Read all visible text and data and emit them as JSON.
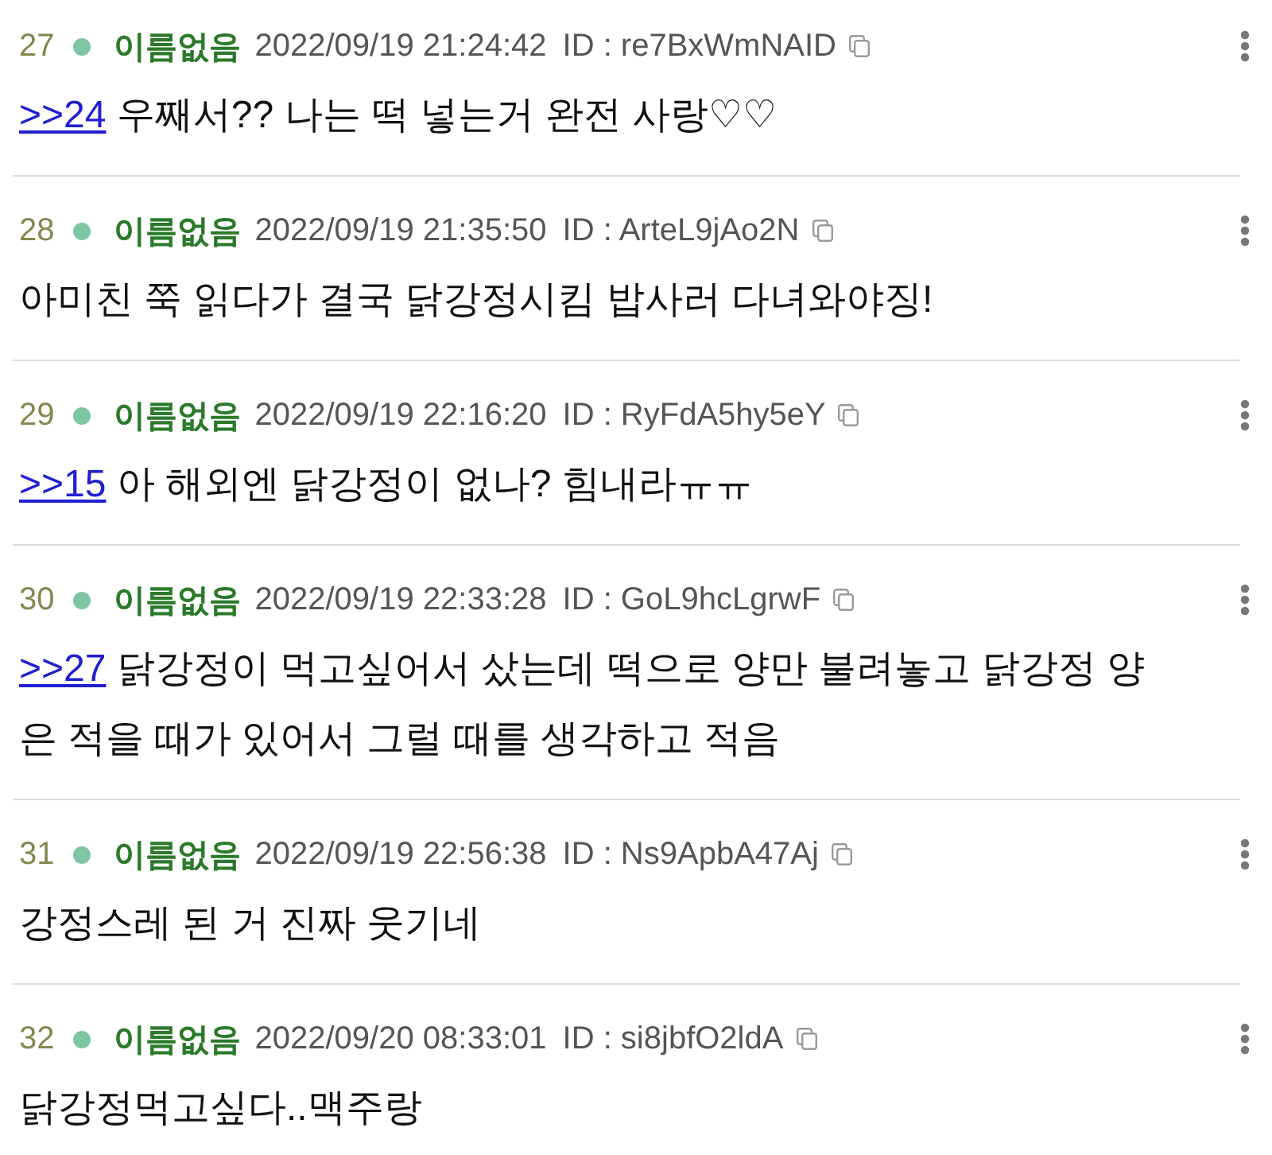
{
  "posts": [
    {
      "number": "27",
      "name": "이름없음",
      "date": "2022/09/19 21:24:42",
      "poster_id": "ID : re7BxWmNAID",
      "reply_to": ">>24",
      "body": "우째서?? 나는 떡 넣는거 완전 사랑♡♡"
    },
    {
      "number": "28",
      "name": "이름없음",
      "date": "2022/09/19 21:35:50",
      "poster_id": "ID : ArteL9jAo2N",
      "body": "아미친 쭉 읽다가 결국 닭강정시킴 밥사러 다녀와야징!"
    },
    {
      "number": "29",
      "name": "이름없음",
      "date": "2022/09/19 22:16:20",
      "poster_id": "ID : RyFdA5hy5eY",
      "reply_to": ">>15",
      "body": "아 해외엔 닭강정이 없나? 힘내라ㅠㅠ"
    },
    {
      "number": "30",
      "name": "이름없음",
      "date": "2022/09/19 22:33:28",
      "poster_id": "ID : GoL9hcLgrwF",
      "reply_to": ">>27",
      "body": "닭강정이 먹고싶어서 샀는데 떡으로 양만 불려놓고 닭강정 양은 적을 때가 있어서 그럴 때를 생각하고 적음"
    },
    {
      "number": "31",
      "name": "이름없음",
      "date": "2022/09/19 22:56:38",
      "poster_id": "ID : Ns9ApbA47Aj",
      "body": "강정스레 된 거 진짜 웃기네"
    },
    {
      "number": "32",
      "name": "이름없음",
      "date": "2022/09/20 08:33:01",
      "poster_id": "ID : si8jbfO2ldA",
      "body": "닭강정먹고싶다..맥주랑"
    }
  ]
}
